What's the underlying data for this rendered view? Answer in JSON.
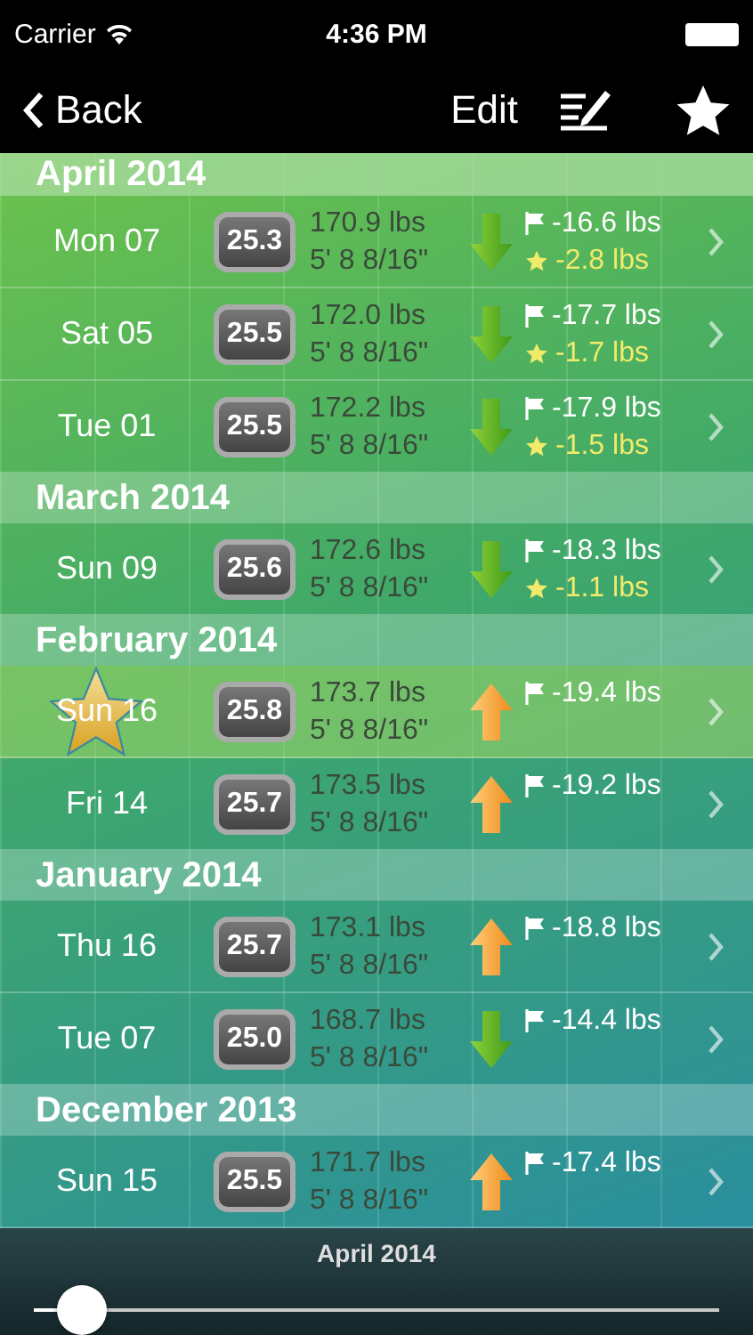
{
  "status_bar": {
    "carrier": "Carrier",
    "time": "4:36 PM"
  },
  "nav_bar": {
    "back": "Back",
    "edit": "Edit"
  },
  "sections": [
    {
      "title": "April 2014",
      "rows": [
        {
          "day": "Mon 07",
          "bmi": "25.3",
          "weight": "170.9 lbs",
          "height": "5' 8 8/16\"",
          "gained": false,
          "goal_change": "-16.6 lbs",
          "star_change": "-2.8 lbs",
          "starred": false
        },
        {
          "day": "Sat 05",
          "bmi": "25.5",
          "weight": "172.0 lbs",
          "height": "5' 8 8/16\"",
          "gained": false,
          "goal_change": "-17.7 lbs",
          "star_change": "-1.7 lbs",
          "starred": false
        },
        {
          "day": "Tue 01",
          "bmi": "25.5",
          "weight": "172.2 lbs",
          "height": "5' 8 8/16\"",
          "gained": false,
          "goal_change": "-17.9 lbs",
          "star_change": "-1.5 lbs",
          "starred": false
        }
      ]
    },
    {
      "title": "March 2014",
      "rows": [
        {
          "day": "Sun 09",
          "bmi": "25.6",
          "weight": "172.6 lbs",
          "height": "5' 8 8/16\"",
          "gained": false,
          "goal_change": "-18.3 lbs",
          "star_change": "-1.1 lbs",
          "starred": false
        }
      ]
    },
    {
      "title": "February 2014",
      "rows": [
        {
          "day": "Sun 16",
          "bmi": "25.8",
          "weight": "173.7 lbs",
          "height": "5' 8 8/16\"",
          "gained": true,
          "goal_change": "-19.4 lbs",
          "starred": true
        },
        {
          "day": "Fri 14",
          "bmi": "25.7",
          "weight": "173.5 lbs",
          "height": "5' 8 8/16\"",
          "gained": true,
          "goal_change": "-19.2 lbs",
          "starred": false
        }
      ]
    },
    {
      "title": "January 2014",
      "rows": [
        {
          "day": "Thu 16",
          "bmi": "25.7",
          "weight": "173.1 lbs",
          "height": "5' 8 8/16\"",
          "gained": true,
          "goal_change": "-18.8 lbs",
          "starred": false
        },
        {
          "day": "Tue 07",
          "bmi": "25.0",
          "weight": "168.7 lbs",
          "height": "5' 8 8/16\"",
          "gained": false,
          "goal_change": "-14.4 lbs",
          "starred": false
        }
      ]
    },
    {
      "title": "December 2013",
      "rows": [
        {
          "day": "Sun 15",
          "bmi": "25.5",
          "weight": "171.7 lbs",
          "height": "5' 8 8/16\"",
          "gained": true,
          "goal_change": "-17.4 lbs",
          "starred": false
        }
      ]
    }
  ],
  "timeline": {
    "label": "April 2014",
    "level": 0.07
  }
}
